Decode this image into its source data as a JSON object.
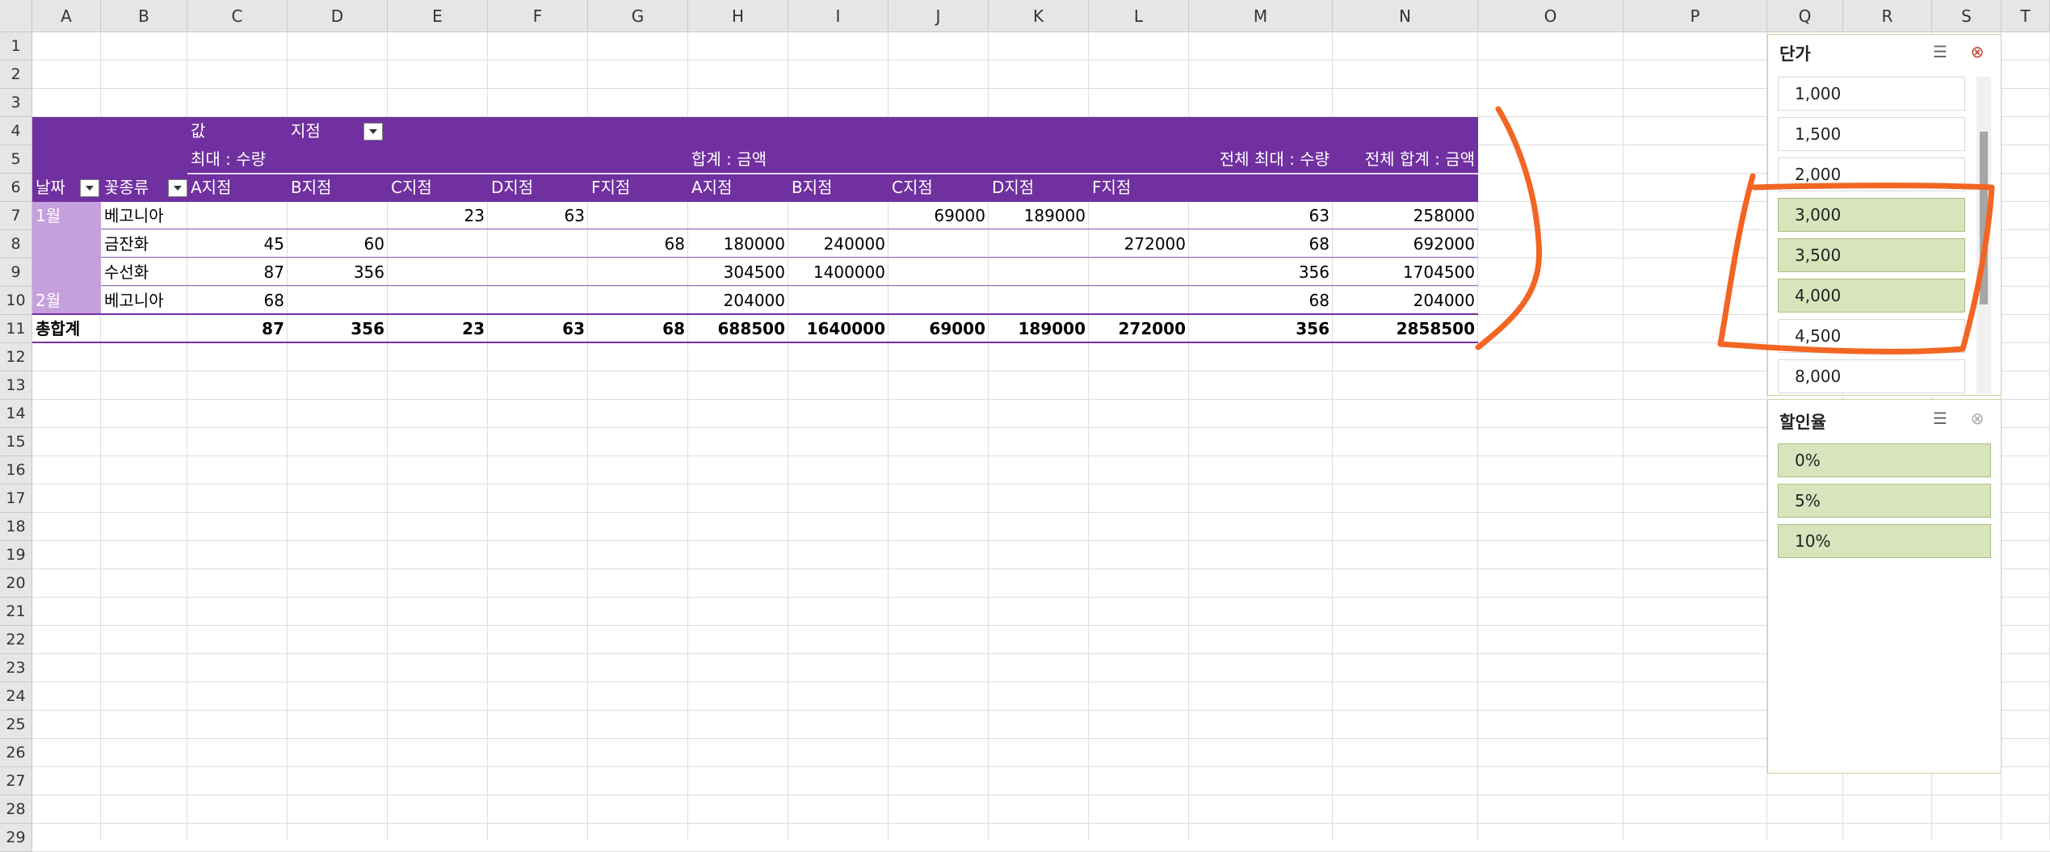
{
  "columns": [
    "A",
    "B",
    "C",
    "D",
    "E",
    "F",
    "G",
    "H",
    "I",
    "J",
    "K",
    "L",
    "M",
    "N",
    "O",
    "P",
    "Q",
    "R",
    "S",
    "T"
  ],
  "rows": [
    "1",
    "2",
    "3",
    "4",
    "5",
    "6",
    "7",
    "8",
    "9",
    "10",
    "11",
    "12",
    "13",
    "14",
    "15",
    "16",
    "17",
    "18",
    "19",
    "20",
    "21",
    "22",
    "23",
    "24",
    "25",
    "26",
    "27",
    "28",
    "29"
  ],
  "pivot": {
    "values_label": "값",
    "branch_field": "지점",
    "header_max_qty": "최대 : 수량",
    "header_sum_amt": "합계 : 금액",
    "header_total_max": "전체 최대 : 수량",
    "header_total_sum": "전체 합계 : 금액",
    "date_field": "날짜",
    "flower_field": "꽃종류",
    "branches_qty": [
      "A지점",
      "B지점",
      "C지점",
      "D지점",
      "F지점"
    ],
    "branches_amt": [
      "A지점",
      "B지점",
      "C지점",
      "D지점",
      "F지점"
    ],
    "data_rows": [
      {
        "month": "1월",
        "flower": "베고니아",
        "vals": [
          "",
          "",
          "23",
          "63",
          "",
          "",
          "",
          "69000",
          "189000",
          "",
          "63",
          "258000"
        ]
      },
      {
        "month": "",
        "flower": "금잔화",
        "vals": [
          "45",
          "60",
          "",
          "",
          "68",
          "180000",
          "240000",
          "",
          "",
          "272000",
          "68",
          "692000"
        ]
      },
      {
        "month": "",
        "flower": "수선화",
        "vals": [
          "87",
          "356",
          "",
          "",
          "",
          "304500",
          "1400000",
          "",
          "",
          "",
          "356",
          "1704500"
        ]
      },
      {
        "month": "2월",
        "flower": "베고니아",
        "vals": [
          "68",
          "",
          "",
          "",
          "",
          "204000",
          "",
          "",
          "",
          "",
          "68",
          "204000"
        ]
      }
    ],
    "grand_total_label": "총합계",
    "grand_total_vals": [
      "87",
      "356",
      "23",
      "63",
      "68",
      "688500",
      "1640000",
      "69000",
      "189000",
      "272000",
      "356",
      "2858500"
    ]
  },
  "slicer_price": {
    "title": "단가",
    "items": [
      {
        "label": "1,000",
        "selected": false
      },
      {
        "label": "1,500",
        "selected": false
      },
      {
        "label": "2,000",
        "selected": false
      },
      {
        "label": "3,000",
        "selected": true
      },
      {
        "label": "3,500",
        "selected": true
      },
      {
        "label": "4,000",
        "selected": true
      },
      {
        "label": "4,500",
        "selected": false
      },
      {
        "label": "8,000",
        "selected": false
      }
    ]
  },
  "slicer_discount": {
    "title": "할인율",
    "items": [
      {
        "label": "0%",
        "selected": true
      },
      {
        "label": "5%",
        "selected": true
      },
      {
        "label": "10%",
        "selected": true
      }
    ]
  },
  "icons": {
    "multiselect": "multi-select-icon",
    "clearfilter": "clear-filter-icon",
    "filter": "filter-icon",
    "dropdown": "dropdown-arrow-icon"
  },
  "colors": {
    "pivot_header": "#7030a0",
    "pivot_rowlabel": "#c5a0dc",
    "slicer_selected": "#d7e4bc",
    "annotation": "#f26522"
  }
}
